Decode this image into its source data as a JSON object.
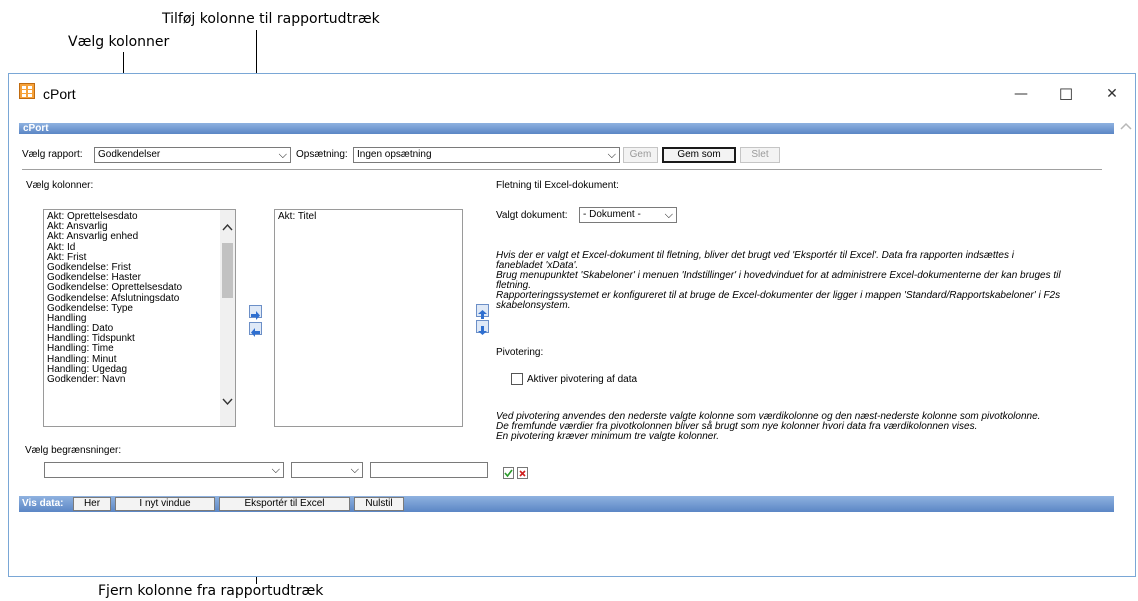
{
  "annotations": {
    "add_column": "Tilføj kolonne til rapportudtræk",
    "choose_columns": "Vælg kolonner",
    "remove_column": "Fjern kolonne fra rapportudtræk"
  },
  "window": {
    "title": "cPort",
    "minimize": "—",
    "maximize": "☐",
    "close": "✕"
  },
  "panel": {
    "header": "cPort",
    "report_label": "Vælg rapport:",
    "report_value": "Godkendelser",
    "setup_label": "Opsætning:",
    "setup_value": "Ingen opsætning",
    "save": "Gem",
    "save_as": "Gem som",
    "delete": "Slet"
  },
  "columns": {
    "label": "Vælg kolonner:",
    "available": [
      "Akt: Oprettelsesdato",
      "Akt: Ansvarlig",
      "Akt: Ansvarlig enhed",
      "Akt: Id",
      "Akt: Frist",
      "Godkendelse: Frist",
      "Godkendelse: Haster",
      "Godkendelse: Oprettelsesdato",
      "Godkendelse: Afslutningsdato",
      "Godkendelse: Type",
      "Handling",
      "Handling: Dato",
      "Handling: Tidspunkt",
      "Handling: Time",
      "Handling: Minut",
      "Handling: Ugedag",
      "Godkender: Navn"
    ],
    "selected": [
      "Akt: Titel"
    ]
  },
  "merge": {
    "label": "Fletning til Excel-dokument:",
    "doc_label": "Valgt dokument:",
    "doc_value": "- Dokument -",
    "info": [
      "Hvis der er valgt et Excel-dokument til fletning, bliver det brugt ved 'Eksportér til Excel'. Data fra rapporten indsættes i",
      "fanebladet 'xData'.",
      "Brug menupunktet 'Skabeloner' i menuen 'Indstillinger' i hovedvinduet for at administrere Excel-dokumenterne der kan bruges til",
      "fletning.",
      "Rapporteringssystemet er konfigureret til at bruge de Excel-dokumenter der ligger i mappen 'Standard/Rapportskabeloner' i F2s",
      "skabelonsystem."
    ]
  },
  "pivot": {
    "label": "Pivotering:",
    "checkbox_label": "Aktiver pivotering af data",
    "info": [
      "Ved pivotering anvendes den nederste valgte kolonne som værdikolonne og den næst-nederste kolonne som pivotkolonne.",
      "De fremfunde værdier fra pivotkolonnen bliver så brugt som nye kolonner hvori data fra værdikolonnen vises.",
      "En pivotering kræver minimum tre valgte kolonner."
    ]
  },
  "restrictions": {
    "label": "Vælg begrænsninger:"
  },
  "footer": {
    "label": "Vis data:",
    "here": "Her",
    "new_window": "I nyt vindue",
    "export_excel": "Eksportér til Excel",
    "reset": "Nulstil"
  },
  "icons": {
    "app": "spreadsheet-icon",
    "move_right": "arrow-right-icon",
    "move_left": "arrow-left-icon",
    "move_up": "arrow-up-icon",
    "move_down": "arrow-down-icon",
    "apply": "apply-filter-icon",
    "remove": "remove-filter-icon"
  }
}
